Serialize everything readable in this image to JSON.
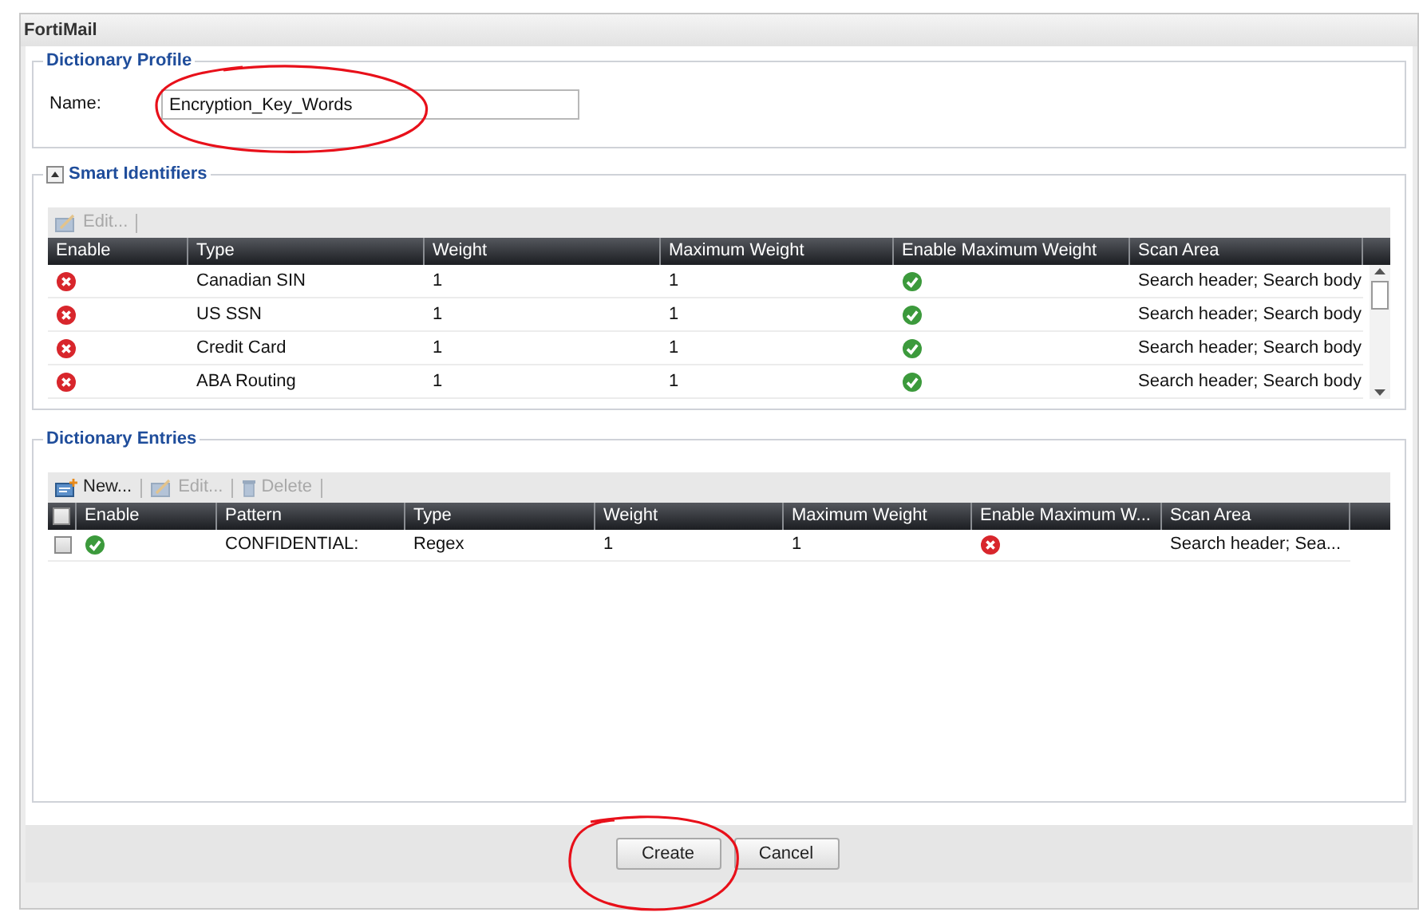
{
  "window": {
    "title": "FortiMail"
  },
  "dictionary_profile": {
    "title": "Dictionary Profile",
    "name_label": "Name:",
    "name_value": "Encryption_Key_Words"
  },
  "smart_identifiers": {
    "title": "Smart Identifiers",
    "expanded": true,
    "toolbar": [
      {
        "kind": "edit",
        "label": "Edit...",
        "disabled": true
      }
    ],
    "columns": [
      "Enable",
      "Type",
      "Weight",
      "Maximum Weight",
      "Enable Maximum Weight",
      "Scan Area"
    ],
    "rows": [
      {
        "enable": false,
        "type": "Canadian SIN",
        "weight": "1",
        "maximum_weight": "1",
        "enable_maximum_weight": true,
        "scan_area": "Search header; Search body"
      },
      {
        "enable": false,
        "type": "US SSN",
        "weight": "1",
        "maximum_weight": "1",
        "enable_maximum_weight": true,
        "scan_area": "Search header; Search body"
      },
      {
        "enable": false,
        "type": "Credit Card",
        "weight": "1",
        "maximum_weight": "1",
        "enable_maximum_weight": true,
        "scan_area": "Search header; Search body"
      },
      {
        "enable": false,
        "type": "ABA Routing",
        "weight": "1",
        "maximum_weight": "1",
        "enable_maximum_weight": true,
        "scan_area": "Search header; Search body"
      }
    ]
  },
  "dictionary_entries": {
    "title": "Dictionary Entries",
    "toolbar": [
      {
        "kind": "new",
        "label": "New...",
        "disabled": false
      },
      {
        "kind": "edit",
        "label": "Edit...",
        "disabled": true
      },
      {
        "kind": "delete",
        "label": "Delete",
        "disabled": true
      }
    ],
    "select_all_checked": false,
    "columns": [
      "Enable",
      "Pattern",
      "Type",
      "Weight",
      "Maximum Weight",
      "Enable Maximum W...",
      "Scan Area"
    ],
    "rows": [
      {
        "checked": false,
        "enable": true,
        "pattern": "CONFIDENTIAL:",
        "type": "Regex",
        "weight": "1",
        "maximum_weight": "1",
        "enable_maximum_weight": false,
        "scan_area": "Search header; Sea..."
      }
    ]
  },
  "buttons": [
    {
      "label": "Create"
    },
    {
      "label": "Cancel"
    }
  ]
}
